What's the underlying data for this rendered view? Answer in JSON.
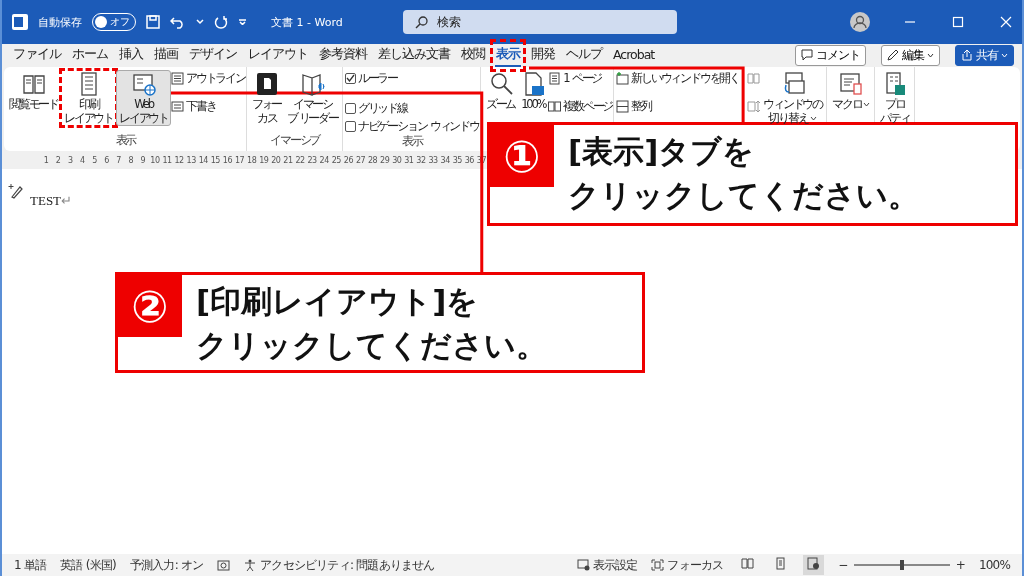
{
  "titlebar": {
    "autosave_label": "自動保存",
    "autosave": {
      "label": "オフ",
      "on": false
    },
    "title": "文書 1  -  Word",
    "search": {
      "placeholder": "検索"
    }
  },
  "tabs": [
    {
      "label": "ファイル",
      "selected": false
    },
    {
      "label": "ホーム",
      "selected": false
    },
    {
      "label": "挿入",
      "selected": false
    },
    {
      "label": "描画",
      "selected": false
    },
    {
      "label": "デザイン",
      "selected": false
    },
    {
      "label": "レイアウト",
      "selected": false
    },
    {
      "label": "参考資料",
      "selected": false
    },
    {
      "label": "差し込み文書",
      "selected": false
    },
    {
      "label": "校閲",
      "selected": false
    },
    {
      "label": "表示",
      "selected": true
    },
    {
      "label": "開発",
      "selected": false
    },
    {
      "label": "ヘルプ",
      "selected": false
    },
    {
      "label": "Acrobat",
      "selected": false
    }
  ],
  "tab_actions": [
    {
      "label": "コメント",
      "kind": "comment"
    },
    {
      "label": "編集",
      "kind": "edit"
    },
    {
      "label": "共有",
      "kind": "share"
    }
  ],
  "ribbon": {
    "groups": [
      {
        "label": "表示",
        "columns": [
          [
            {
              "kind": "large",
              "lines": [
                "閲覧モード"
              ],
              "selected": false
            }
          ],
          [
            {
              "kind": "large",
              "lines": [
                "印刷",
                "レイアウト"
              ],
              "selected": false
            }
          ],
          [
            {
              "kind": "large",
              "lines": [
                "Web",
                "レイアウト"
              ],
              "selected": true
            }
          ],
          [
            {
              "kind": "small",
              "label": "アウトライン"
            },
            {
              "kind": "small",
              "label": "下書き"
            }
          ]
        ]
      },
      {
        "label": "イマーシブ",
        "columns": [
          [
            {
              "kind": "large",
              "lines": [
                "フォー",
                "カス"
              ]
            }
          ],
          [
            {
              "kind": "large",
              "lines": [
                "イマーシ",
                "ブ リーダー"
              ]
            }
          ]
        ]
      },
      {
        "label": "表示",
        "columns": [
          [
            {
              "kind": "check",
              "label": "ルーラー",
              "checked": true
            },
            {
              "kind": "check",
              "label": "グリッド線",
              "checked": false
            },
            {
              "kind": "check",
              "label": "ナビゲーション ウィンドウ",
              "checked": false
            }
          ]
        ]
      },
      {
        "columns": [
          [
            {
              "kind": "large",
              "lines": [
                "ズーム"
              ]
            }
          ],
          [
            {
              "kind": "large",
              "lines": [
                "100%"
              ]
            }
          ],
          [
            {
              "kind": "small",
              "label": "1 ページ"
            },
            {
              "kind": "small",
              "label": "複数ページ"
            }
          ]
        ]
      },
      {
        "columns": [
          [
            {
              "kind": "small",
              "label": "新しいウィンドウを開く"
            },
            {
              "kind": "small",
              "label": "整列"
            }
          ],
          [
            {
              "kind": "icon"
            },
            {
              "kind": "icon"
            }
          ],
          [
            {
              "kind": "large",
              "lines": [
                "ウィンドウの",
                "切り替え"
              ],
              "dropdown": true
            }
          ]
        ]
      },
      {
        "columns": [
          [
            {
              "kind": "large",
              "lines": [
                "マクロ"
              ],
              "dropdown": true
            }
          ]
        ]
      },
      {
        "columns": [
          [
            {
              "kind": "large",
              "lines": [
                "プロ",
                "パティ"
              ]
            }
          ]
        ]
      }
    ]
  },
  "ruler": {
    "labels": [
      "1",
      "2",
      "3",
      "4",
      "5",
      "6",
      "7",
      "8",
      "9",
      "10",
      "11",
      "12",
      "13",
      "14",
      "15",
      "16",
      "17",
      "18",
      "19",
      "20",
      "21",
      "22",
      "23",
      "24",
      "25",
      "26",
      "27",
      "28",
      "29",
      "30",
      "31",
      "32",
      "33",
      "34",
      "35",
      "36",
      "37"
    ]
  },
  "document": {
    "paragraphs": [
      "TEST"
    ],
    "paragraph_mark": "↵"
  },
  "status_bar": {
    "left": [
      "1 単語",
      "英語 (米国)",
      "予測入力: オン"
    ],
    "accessibility": "アクセシビリティ: 問題ありません",
    "display_settings": "表示設定",
    "focus": "フォーカス",
    "views": [
      {
        "selected": false
      },
      {
        "selected": false
      },
      {
        "selected": true
      }
    ],
    "zoom": {
      "minus": "−",
      "level": 0.5,
      "plus": "+",
      "reading": "100%"
    }
  },
  "annotations": [
    {
      "number": "①",
      "lines": [
        "[表示]タブを",
        "クリックしてください。"
      ]
    },
    {
      "number": "②",
      "lines": [
        "[印刷レイアウト]を",
        "クリックしてください。"
      ]
    }
  ]
}
